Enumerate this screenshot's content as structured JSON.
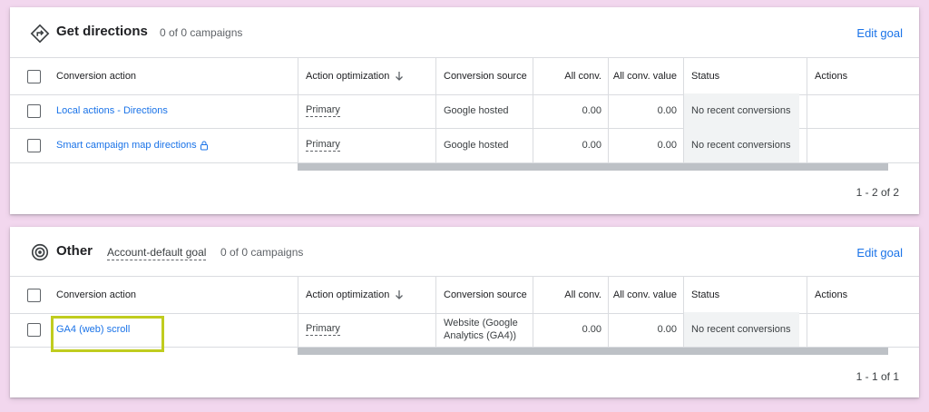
{
  "goals": [
    {
      "title": "Get directions",
      "icon": "directions-icon",
      "campaigns": "0 of 0 campaigns",
      "edit_label": "Edit goal",
      "columns": {
        "conversion_action": "Conversion action",
        "action_optimization": "Action optimization",
        "conversion_source": "Conversion source",
        "all_conv": "All conv.",
        "all_conv_value": "All conv. value",
        "status": "Status",
        "actions": "Actions"
      },
      "rows": [
        {
          "name": "Local actions - Directions",
          "optimization": "Primary",
          "source": "Google hosted",
          "all_conv": "0.00",
          "all_conv_value": "0.00",
          "status": "No recent conversions"
        },
        {
          "name": "Smart campaign map directions",
          "optimization": "Primary",
          "source": "Google hosted",
          "all_conv": "0.00",
          "all_conv_value": "0.00",
          "status": "No recent conversions"
        }
      ],
      "pagination": "1 - 2 of 2"
    },
    {
      "title": "Other",
      "icon": "target-icon",
      "default_label": "Account-default goal",
      "campaigns": "0 of 0 campaigns",
      "edit_label": "Edit goal",
      "columns": {
        "conversion_action": "Conversion action",
        "action_optimization": "Action optimization",
        "conversion_source": "Conversion source",
        "all_conv": "All conv.",
        "all_conv_value": "All conv. value",
        "status": "Status",
        "actions": "Actions"
      },
      "rows": [
        {
          "name": "GA4 (web) scroll",
          "optimization": "Primary",
          "source": "Website (Google Analytics (GA4))",
          "all_conv": "0.00",
          "all_conv_value": "0.00",
          "status": "No recent conversions"
        }
      ],
      "pagination": "1 - 1 of 1"
    }
  ],
  "colors": {
    "link": "#1a73e8",
    "highlight": "#c0cc1f",
    "background": "#f2d7ee"
  }
}
